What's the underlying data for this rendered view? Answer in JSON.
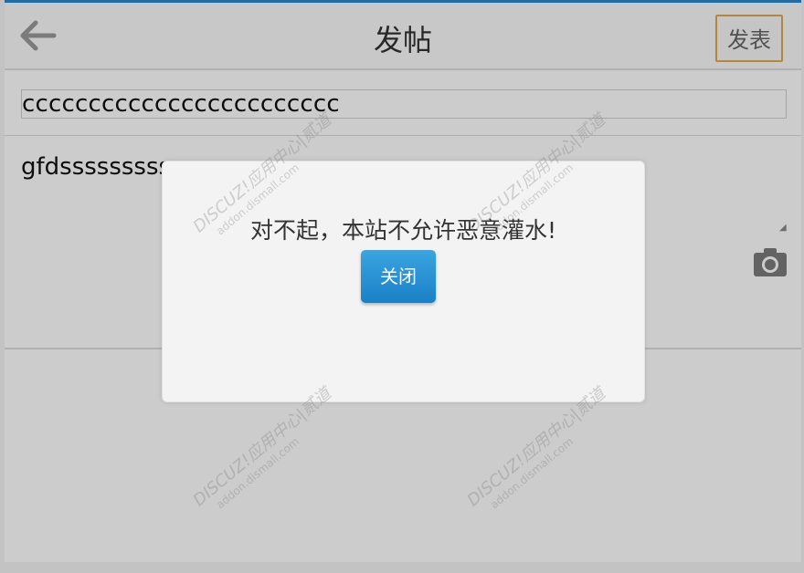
{
  "header": {
    "title": "发帖",
    "publish_label": "发表"
  },
  "form": {
    "subject_value": "cccccccccccccccccccccccc",
    "content_value": "gfdsssssssss"
  },
  "dialog": {
    "message": "对不起，本站不允许恶意灌水!",
    "close_label": "关闭"
  },
  "watermark": {
    "brand": "DISCUZ!应用中心|贰道",
    "url": "addon.dismall.com"
  },
  "icons": {
    "back": "arrow-left-icon",
    "camera": "camera-icon"
  },
  "colors": {
    "accent": "#2a86c6",
    "publish_border": "#e2a94c",
    "dialog_button": "#1f8fd4"
  }
}
